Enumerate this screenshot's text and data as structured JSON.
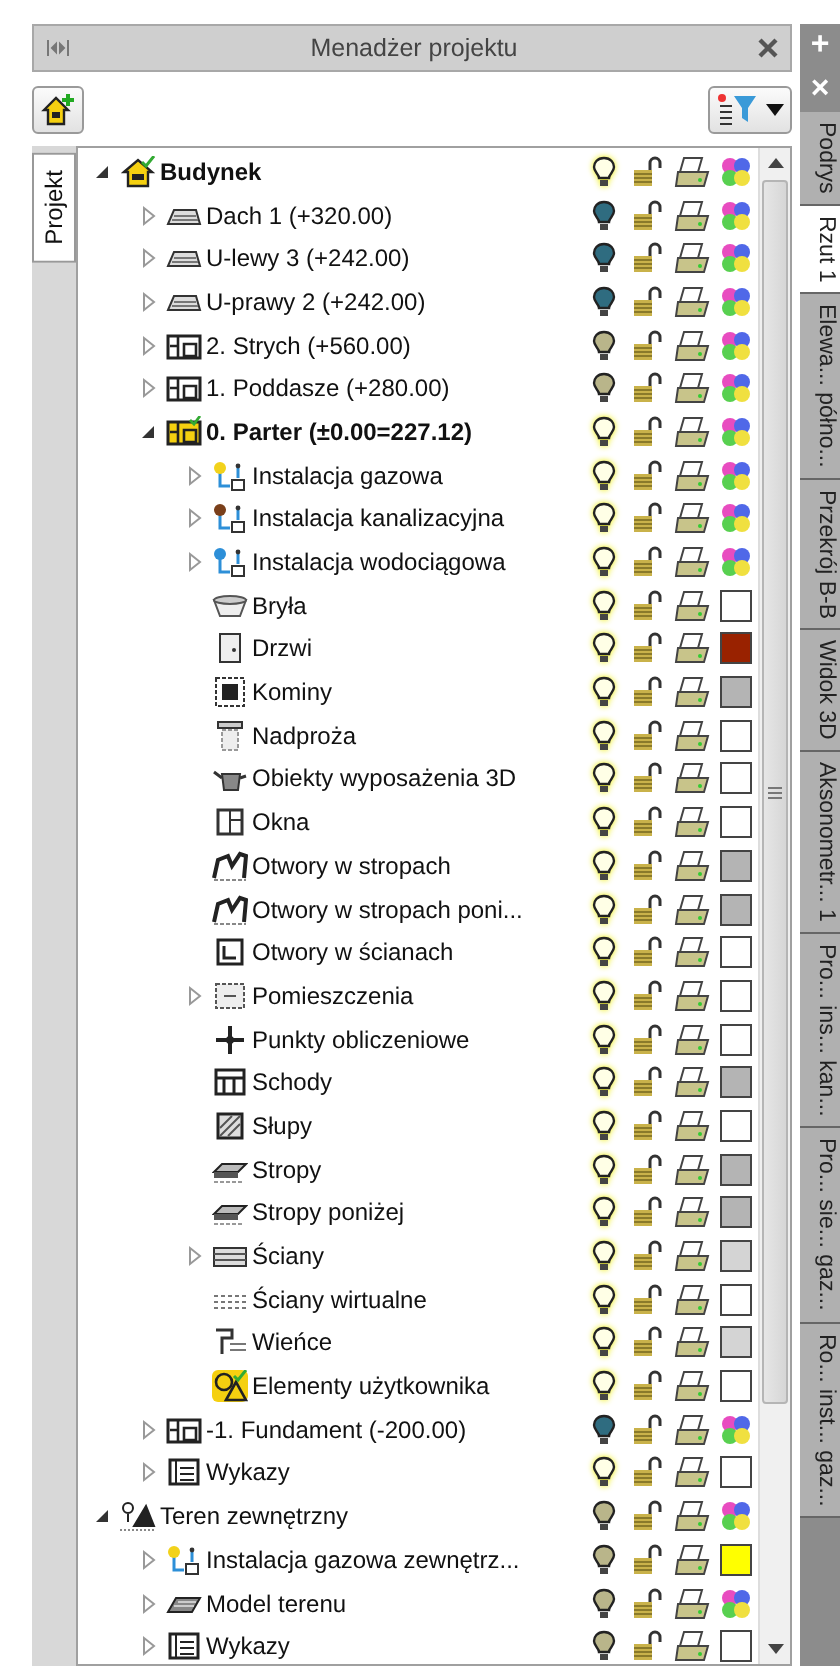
{
  "panel": {
    "title": "Menadżer projektu"
  },
  "left_tabs": [
    {
      "label": "Projekt",
      "selected": true
    }
  ],
  "tree": [
    {
      "label": "Budynek",
      "kind": "house",
      "bold": true,
      "expanded": true,
      "visible": true,
      "active": true,
      "children": [
        {
          "label": "Dach 1 (+320.00)",
          "kind": "roof",
          "expanded": false,
          "visible": false,
          "active": false
        },
        {
          "label": "U-lewy 3 (+242.00)",
          "kind": "roof",
          "expanded": false,
          "visible": false,
          "active": false
        },
        {
          "label": "U-prawy 2 (+242.00)",
          "kind": "roof",
          "expanded": false,
          "visible": false,
          "active": false
        },
        {
          "label": "2. Strych (+560.00)",
          "kind": "storey",
          "expanded": false,
          "visible": true,
          "active": false
        },
        {
          "label": "1. Poddasze (+280.00)",
          "kind": "storey",
          "expanded": false,
          "visible": true,
          "active": false
        },
        {
          "label": "0. Parter (±0.00=227.12)",
          "kind": "current-storey",
          "bold": true,
          "expanded": true,
          "visible": true,
          "active": true,
          "children": [
            {
              "label": "Instalacja gazowa",
              "kind": "gas",
              "expanded": false,
              "visible": true,
              "active": true
            },
            {
              "label": "Instalacja kanalizacyjna",
              "kind": "sewer",
              "expanded": false,
              "visible": true,
              "active": true
            },
            {
              "label": "Instalacja wodociągowa",
              "kind": "water",
              "expanded": false,
              "visible": true,
              "active": true
            },
            {
              "label": "Bryła",
              "kind": "solid",
              "visible": true,
              "active": true,
              "color": "#ffffff"
            },
            {
              "label": "Drzwi",
              "kind": "door",
              "visible": true,
              "active": true,
              "color": "#992200"
            },
            {
              "label": "Kominy",
              "kind": "chimney",
              "visible": true,
              "active": true,
              "color": "#b4b4b4"
            },
            {
              "label": "Nadproża",
              "kind": "lintel",
              "visible": true,
              "active": true,
              "color": "#ffffff"
            },
            {
              "label": "Obiekty wyposażenia 3D",
              "kind": "furniture",
              "visible": true,
              "active": true,
              "color": "#ffffff"
            },
            {
              "label": "Okna",
              "kind": "window",
              "visible": true,
              "active": true,
              "color": "#ffffff"
            },
            {
              "label": "Otwory w stropach",
              "kind": "slab-opening",
              "visible": true,
              "active": true,
              "color": "#b4b4b4"
            },
            {
              "label": "Otwory w stropach poni...",
              "kind": "slab-opening",
              "visible": true,
              "active": true,
              "color": "#b4b4b4"
            },
            {
              "label": "Otwory w ścianach",
              "kind": "wall-opening",
              "visible": true,
              "active": true,
              "color": "#ffffff"
            },
            {
              "label": "Pomieszczenia",
              "kind": "room",
              "expanded": false,
              "visible": true,
              "active": true,
              "color": "#ffffff"
            },
            {
              "label": "Punkty obliczeniowe",
              "kind": "point",
              "visible": true,
              "active": true,
              "color": "#ffffff"
            },
            {
              "label": "Schody",
              "kind": "stairs",
              "visible": true,
              "active": true,
              "color": "#b4b4b4"
            },
            {
              "label": "Słupy",
              "kind": "column",
              "visible": true,
              "active": true,
              "color": "#ffffff"
            },
            {
              "label": "Stropy",
              "kind": "slab",
              "visible": true,
              "active": true,
              "color": "#b4b4b4"
            },
            {
              "label": "Stropy poniżej",
              "kind": "slab",
              "visible": true,
              "active": true,
              "color": "#b4b4b4"
            },
            {
              "label": "Ściany",
              "kind": "wall",
              "expanded": false,
              "visible": true,
              "active": true,
              "color": "#d4d4d4"
            },
            {
              "label": "Ściany wirtualne",
              "kind": "virtual-wall",
              "visible": true,
              "active": true,
              "color": "#ffffff"
            },
            {
              "label": "Wieńce",
              "kind": "beam",
              "visible": true,
              "active": true,
              "color": "#d4d4d4"
            },
            {
              "label": "Elementy użytkownika",
              "kind": "user",
              "visible": true,
              "active": true,
              "color": "#ffffff"
            }
          ]
        },
        {
          "label": "-1. Fundament (-200.00)",
          "kind": "storey",
          "expanded": false,
          "visible": false,
          "active": false
        },
        {
          "label": "Wykazy",
          "kind": "list",
          "expanded": false,
          "visible": true,
          "active": true,
          "color": "#ffffff"
        }
      ]
    },
    {
      "label": "Teren zewnętrzny",
      "kind": "terrain",
      "expanded": true,
      "visible": true,
      "active": false,
      "children": [
        {
          "label": "Instalacja gazowa zewnętrz...",
          "kind": "gas",
          "expanded": false,
          "visible": true,
          "active": false,
          "color": "#ffff00"
        },
        {
          "label": "Model terenu",
          "kind": "terrain-model",
          "expanded": false,
          "visible": true,
          "active": false
        },
        {
          "label": "Wykazy",
          "kind": "list",
          "expanded": false,
          "visible": true,
          "active": false,
          "color": "#ffffff"
        }
      ]
    }
  ],
  "side_tabs": [
    {
      "label": "+",
      "kind": "action"
    },
    {
      "label": "×",
      "kind": "action"
    },
    {
      "label": "Podrys",
      "kind": "tab",
      "selected": false
    },
    {
      "label": "Rzut 1",
      "kind": "tab",
      "selected": true
    },
    {
      "label": "Elewa... półno...",
      "kind": "tab",
      "selected": false
    },
    {
      "label": "Przekrój B-B",
      "kind": "tab",
      "selected": false
    },
    {
      "label": "Widok 3D",
      "kind": "tab",
      "selected": false
    },
    {
      "label": "Aksonometr... 1",
      "kind": "tab",
      "selected": false
    },
    {
      "label": "Pro... ins... kan...",
      "kind": "tab",
      "selected": false
    },
    {
      "label": "Pro... sie... gaz...",
      "kind": "tab",
      "selected": false
    },
    {
      "label": "Ro... inst... gaz...",
      "kind": "tab",
      "selected": false
    }
  ]
}
